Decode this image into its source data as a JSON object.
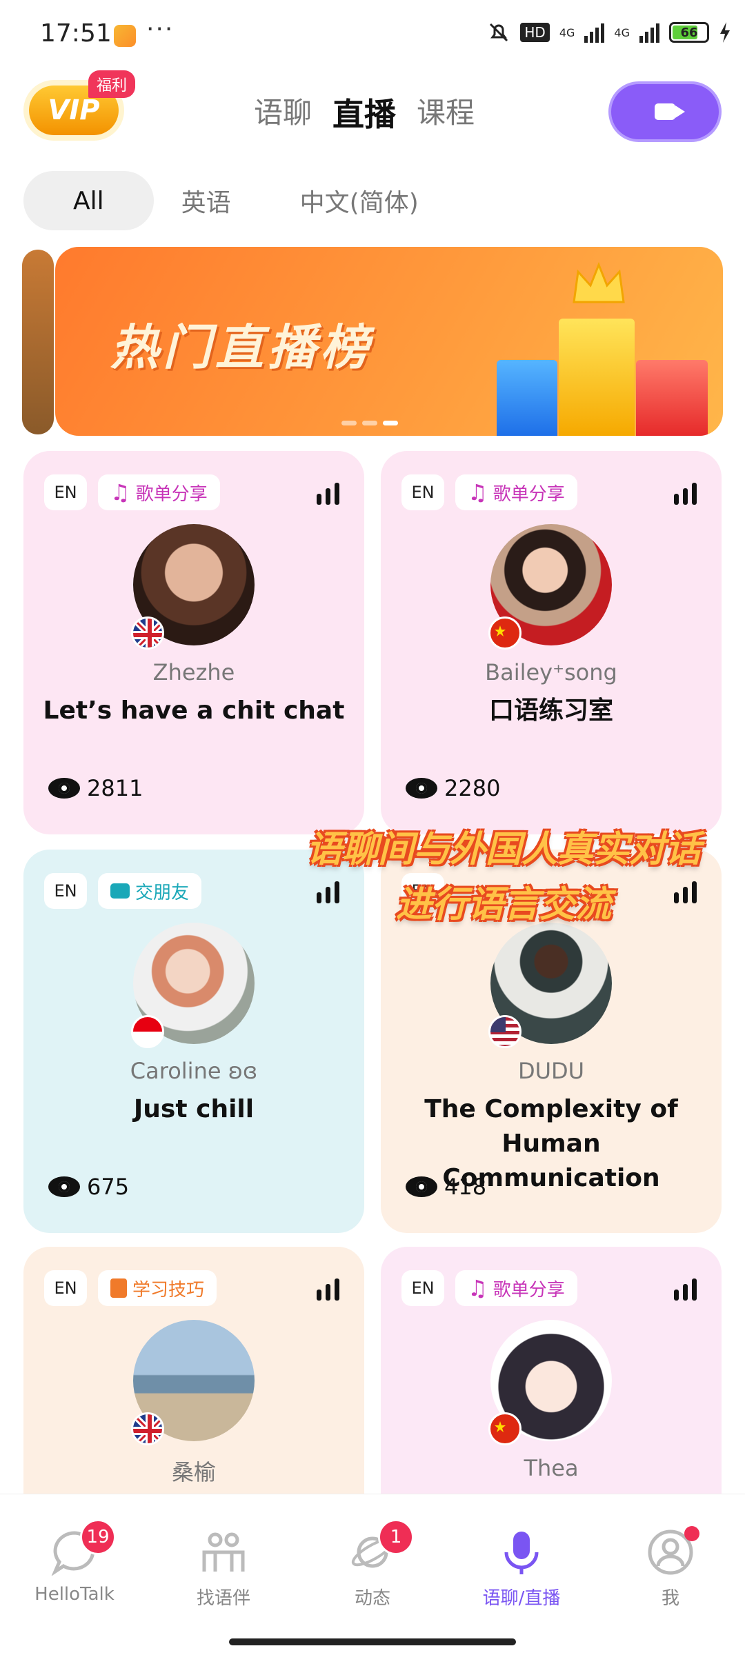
{
  "status_bar": {
    "time": "17:51",
    "more": "···",
    "hd": "HD",
    "net1": "4G",
    "net2": "4G",
    "battery": "66"
  },
  "header": {
    "vip_label": "VIP",
    "vip_badge": "福利",
    "tabs": [
      {
        "label": "语聊"
      },
      {
        "label": "直播"
      },
      {
        "label": "课程"
      }
    ],
    "active_tab": "直播"
  },
  "filters": {
    "items": [
      {
        "label": "All"
      },
      {
        "label": "英语"
      },
      {
        "label": "中文(简体)"
      }
    ],
    "active": "All"
  },
  "banner": {
    "title": "热门直播榜",
    "pages": 3,
    "current_page": 3
  },
  "rooms": [
    {
      "lang": "EN",
      "tag": "歌单分享",
      "tag_color": "#c734b8",
      "host": "Zhezhe",
      "title": "Let’s have a chit chat",
      "views": "2811",
      "flag": "uk"
    },
    {
      "lang": "EN",
      "tag": "歌单分享",
      "tag_color": "#c734b8",
      "host": "Bailey⁺song",
      "title": "口语练习室",
      "views": "2280",
      "flag": "cn"
    },
    {
      "lang": "EN",
      "tag": "交朋友",
      "tag_color": "#1aa8b8",
      "host": "Caroline ʚɞ",
      "title": "Just chill",
      "views": "675",
      "flag": "id"
    },
    {
      "lang": "EN",
      "tag": "",
      "tag_color": "#c734b8",
      "host": "DUDU",
      "title": "The Complexity of Human Communication",
      "views": "418",
      "flag": "us"
    },
    {
      "lang": "EN",
      "tag": "学习技巧",
      "tag_color": "#f07a2a",
      "host": "桑榆",
      "title": "",
      "views": "",
      "flag": "uk"
    },
    {
      "lang": "EN",
      "tag": "歌单分享",
      "tag_color": "#c734b8",
      "host": "Thea",
      "title": "",
      "views": "",
      "flag": "cn"
    }
  ],
  "overlay_caption": {
    "line1": "语聊间与外国人真实对话",
    "line2": "进行语言交流"
  },
  "bottom_nav": {
    "items": [
      {
        "label": "HelloTalk",
        "badge": "19"
      },
      {
        "label": "找语伴",
        "badge": ""
      },
      {
        "label": "动态",
        "badge": "1"
      },
      {
        "label": "语聊/直播",
        "badge": ""
      },
      {
        "label": "我",
        "badge": ""
      }
    ],
    "active": "语聊/直播"
  },
  "colors": {
    "accent": "#8a5cf8",
    "badge": "#ef2e55"
  }
}
